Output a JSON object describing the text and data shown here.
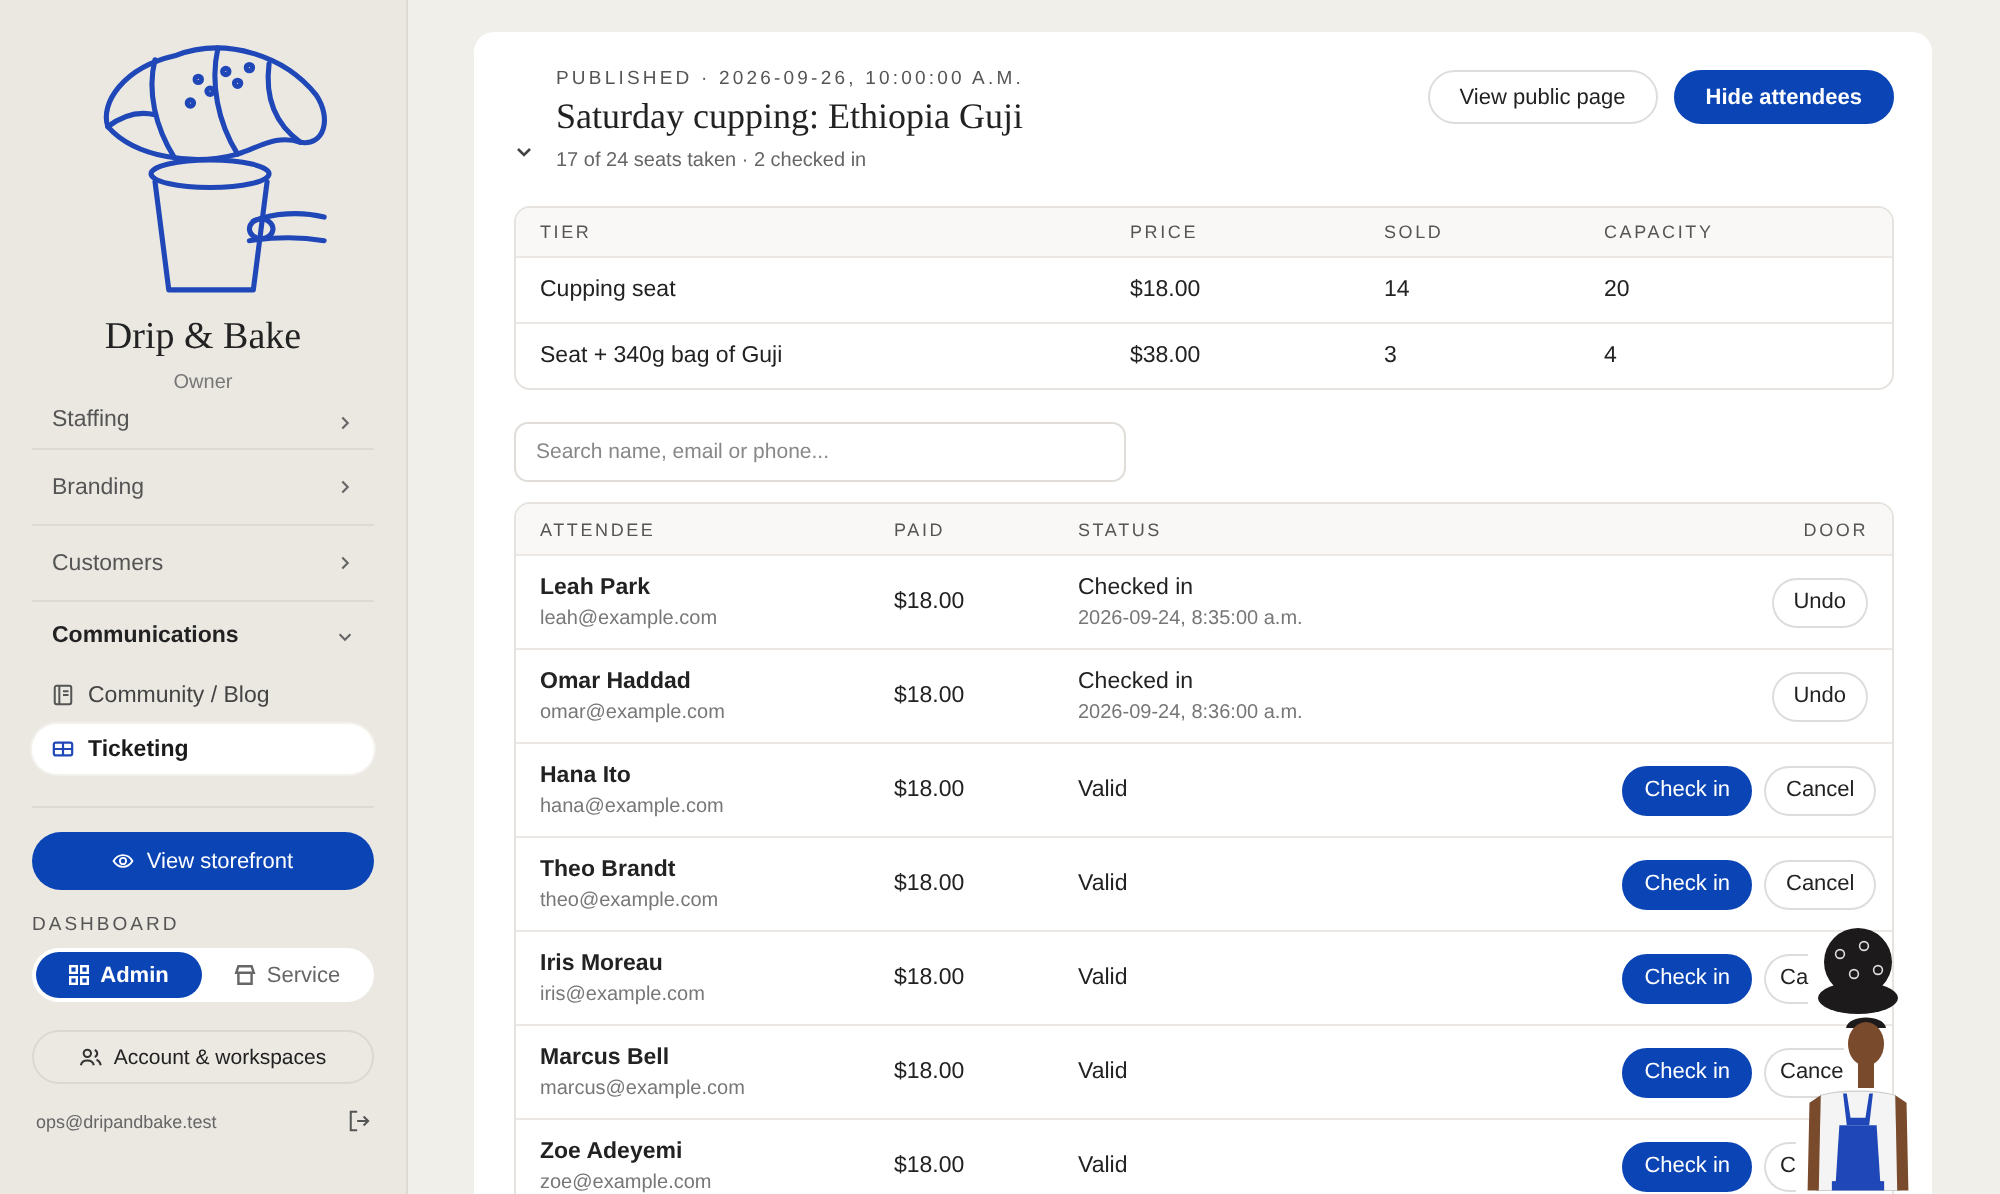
{
  "brand": {
    "name": "Drip & Bake",
    "role": "Owner"
  },
  "nav": [
    {
      "label": "Staffing",
      "kind": "group",
      "expanded": false,
      "selected": false
    },
    {
      "label": "Branding",
      "kind": "group",
      "expanded": false,
      "selected": false
    },
    {
      "label": "Customers",
      "kind": "group",
      "expanded": false,
      "selected": false
    },
    {
      "label": "Communications",
      "kind": "group",
      "expanded": true,
      "selected": false
    },
    {
      "label": "Community / Blog",
      "kind": "blog",
      "selected": false
    },
    {
      "label": "Ticketing",
      "kind": "ticket",
      "selected": true
    }
  ],
  "storefront_button": "View storefront",
  "dashboard": {
    "label": "DASHBOARD",
    "options": [
      {
        "label": "Admin",
        "kind": "grid",
        "selected": true
      },
      {
        "label": "Service",
        "kind": "store",
        "selected": false
      }
    ]
  },
  "account_button": "Account & workspaces",
  "user_email": "ops@dripandbake.test",
  "event": {
    "published": "PUBLISHED · 2026-09-26, 10:00:00 A.M.",
    "title": "Saturday cupping: Ethiopia Guji",
    "summary": "17 of 24 seats taken · 2 checked in",
    "expanded": true,
    "buttons": [
      {
        "label": "View public page",
        "kind": "outline"
      },
      {
        "label": "Hide attendees",
        "kind": "primary"
      }
    ]
  },
  "tiers": {
    "columns": [
      "TIER",
      "PRICE",
      "SOLD",
      "CAPACITY"
    ],
    "rows": [
      [
        "Cupping seat",
        "$18.00",
        "14",
        "20"
      ],
      [
        "Seat + 340g bag of Guji",
        "$38.00",
        "3",
        "4"
      ]
    ]
  },
  "search": {
    "placeholder": "Search name, email or phone..."
  },
  "attendees": {
    "columns": [
      "ATTENDEE",
      "PAID",
      "STATUS",
      "DOOR"
    ],
    "rows": [
      {
        "name": "Leah Park",
        "email": "leah@example.com",
        "paid": "$18.00",
        "status": "Checked in",
        "status_time": "2026-09-24, 8:35:00 a.m.",
        "actions": [
          {
            "label": "Undo",
            "kind": "outline",
            "clipped": false
          }
        ]
      },
      {
        "name": "Omar Haddad",
        "email": "omar@example.com",
        "paid": "$18.00",
        "status": "Checked in",
        "status_time": "2026-09-24, 8:36:00 a.m.",
        "actions": [
          {
            "label": "Undo",
            "kind": "outline",
            "clipped": false
          }
        ]
      },
      {
        "name": "Hana Ito",
        "email": "hana@example.com",
        "paid": "$18.00",
        "status": "Valid",
        "actions": [
          {
            "label": "Check in",
            "kind": "primary",
            "clipped": false
          },
          {
            "label": "Cancel",
            "kind": "outline",
            "clipped": false
          }
        ]
      },
      {
        "name": "Theo Brandt",
        "email": "theo@example.com",
        "paid": "$18.00",
        "status": "Valid",
        "actions": [
          {
            "label": "Check in",
            "kind": "primary",
            "clipped": false
          },
          {
            "label": "Cancel",
            "kind": "outline",
            "clipped": false
          }
        ]
      },
      {
        "name": "Iris Moreau",
        "email": "iris@example.com",
        "paid": "$18.00",
        "status": "Valid",
        "actions": [
          {
            "label": "Check in",
            "kind": "primary",
            "clipped": false
          },
          {
            "label": "Ca",
            "kind": "outline",
            "clipped": true
          }
        ]
      },
      {
        "name": "Marcus Bell",
        "email": "marcus@example.com",
        "paid": "$18.00",
        "status": "Valid",
        "actions": [
          {
            "label": "Check in",
            "kind": "primary",
            "clipped": false
          },
          {
            "label": "Cance",
            "kind": "outline",
            "clipped": true
          }
        ]
      },
      {
        "name": "Zoe Adeyemi",
        "email": "zoe@example.com",
        "paid": "$18.00",
        "status": "Valid",
        "actions": [
          {
            "label": "Check in",
            "kind": "primary",
            "clipped": false
          },
          {
            "label": "C",
            "kind": "outline",
            "clipped": true
          }
        ]
      }
    ]
  }
}
